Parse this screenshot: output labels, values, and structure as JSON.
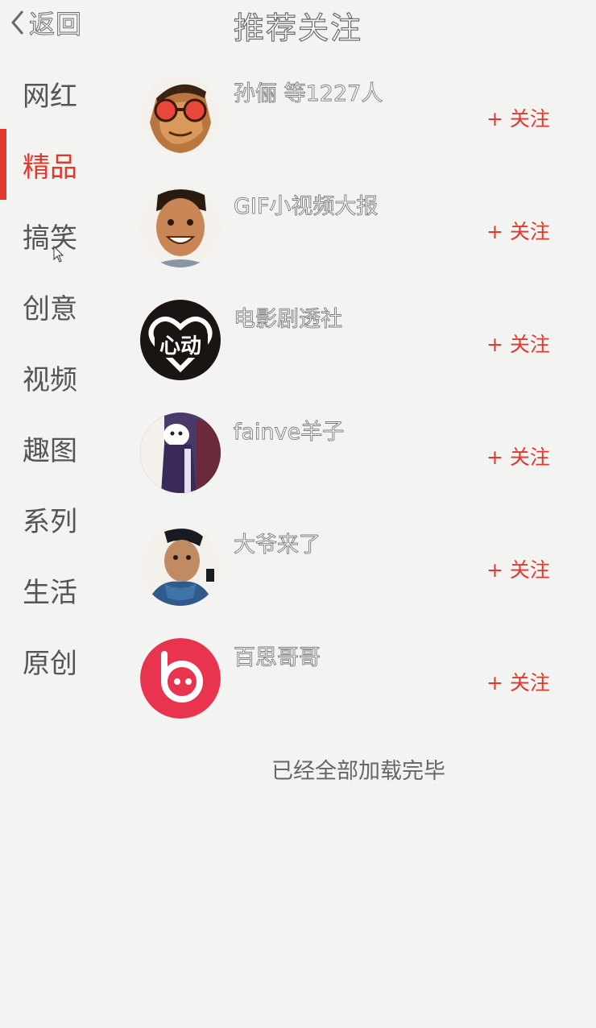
{
  "header": {
    "back_label": "返回",
    "title": "推荐关注"
  },
  "sidebar": {
    "items": [
      {
        "label": "网红",
        "active": false
      },
      {
        "label": "精品",
        "active": true
      },
      {
        "label": "搞笑",
        "active": false
      },
      {
        "label": "创意",
        "active": false
      },
      {
        "label": "视频",
        "active": false
      },
      {
        "label": "趣图",
        "active": false
      },
      {
        "label": "系列",
        "active": false
      },
      {
        "label": "生活",
        "active": false
      },
      {
        "label": "原创",
        "active": false
      }
    ]
  },
  "list": {
    "follow_label": "+ 关注",
    "items": [
      {
        "name": "孙俪 等1227人"
      },
      {
        "name": "GIF小视频大报"
      },
      {
        "name": "电影剧透社"
      },
      {
        "name": "fainve羊子"
      },
      {
        "name": "大爷来了"
      },
      {
        "name": "百思哥哥"
      }
    ],
    "avatar3_text": "心动"
  },
  "footer": {
    "text": "已经全部加载完毕"
  },
  "colors": {
    "accent": "#e03a2f",
    "background": "#f3f3f2",
    "text": "#555555"
  }
}
